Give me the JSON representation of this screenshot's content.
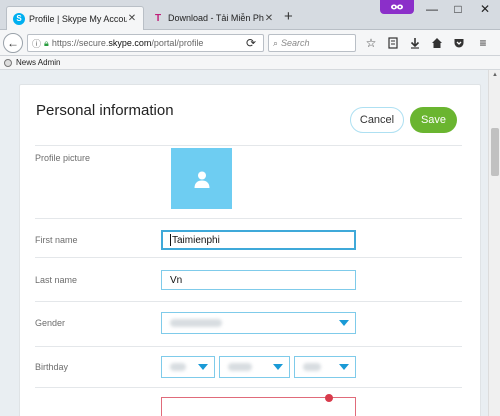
{
  "browser": {
    "tabs": [
      {
        "label": "Profile | Skype My Account",
        "active": true,
        "favicon": "skype-icon"
      },
      {
        "label": "Download - Tải Miễn Phí ...",
        "active": false,
        "favicon": "taimienphi-icon"
      }
    ],
    "new_tab_label": "+",
    "window_controls": {
      "minimize": "—",
      "maximize": "□",
      "close": "✕"
    },
    "url": {
      "scheme": "https://secure.",
      "host": "skype.com",
      "path": "/portal/profile"
    },
    "search_placeholder": "Search",
    "bookmarks": [
      {
        "label": "News Admin"
      }
    ]
  },
  "page": {
    "title": "Personal information",
    "cancel_label": "Cancel",
    "save_label": "Save",
    "profile_picture_label": "Profile picture",
    "first_name": {
      "label": "First name",
      "value": "Taimienphi"
    },
    "last_name": {
      "label": "Last name",
      "value": "Vn"
    },
    "gender_label": "Gender",
    "birthday_label": "Birthday"
  },
  "colors": {
    "save_button": "#6ab530",
    "field_border": "#7fcbea",
    "avatar_bg": "#6ecdf2",
    "skype_blue": "#00aff0",
    "private_purple": "#8b2fc9"
  }
}
